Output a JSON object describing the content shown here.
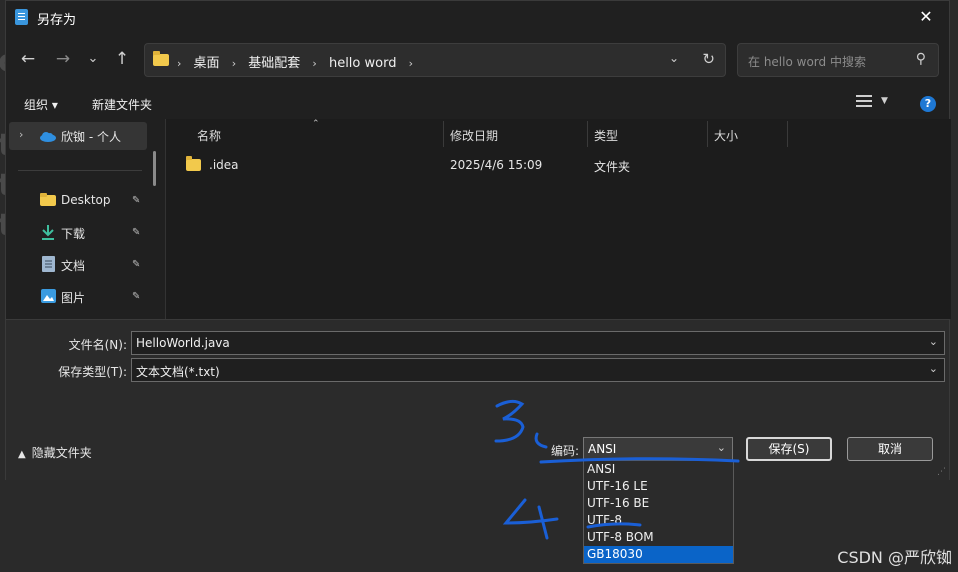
{
  "window": {
    "title": "另存为",
    "close_symbol": "✕"
  },
  "nav": {
    "back": "←",
    "forward": "→",
    "recent": "⌄",
    "up": "↑",
    "refresh": "↻"
  },
  "address": {
    "crumbs": [
      "桌面",
      "基础配套",
      "hello word"
    ],
    "separator": "›",
    "dropdown": "⌄"
  },
  "search": {
    "placeholder": "在 hello word 中搜索",
    "icon": "search-icon"
  },
  "toolbar": {
    "organize": "组织 ▾",
    "new_folder": "新建文件夹",
    "help": "?"
  },
  "sidebar": {
    "top_item": {
      "label": "欣铷 - 个人",
      "icon": "cloud-icon",
      "expander": "›"
    },
    "items": [
      {
        "label": "Desktop",
        "icon": "folder-icon"
      },
      {
        "label": "下载",
        "icon": "download-icon"
      },
      {
        "label": "文档",
        "icon": "document-icon"
      },
      {
        "label": "图片",
        "icon": "image-icon"
      }
    ],
    "pin_symbol": "📌"
  },
  "columns": [
    "名称",
    "修改日期",
    "类型",
    "大小"
  ],
  "sort_indicator": "⌃",
  "files": [
    {
      "name": ".idea",
      "modified": "2025/4/6 15:09",
      "type": "文件夹",
      "size": ""
    }
  ],
  "form": {
    "filename_label": "文件名(N):",
    "filename_value": "HelloWorld.java",
    "filetype_label": "保存类型(T):",
    "filetype_value": "文本文档(*.txt)",
    "hide_folders": "隐藏文件夹",
    "encoding_label": "编码:",
    "encoding_value": "ANSI",
    "save": "保存(S)",
    "cancel": "取消"
  },
  "encoding_options": [
    "ANSI",
    "UTF-16 LE",
    "UTF-16 BE",
    "UTF-8",
    "UTF-8 BOM",
    "GB18030"
  ],
  "encoding_highlighted": "GB18030",
  "annotations": {
    "step3": "3",
    "step4": "4",
    "color": "#1a5fd6"
  },
  "watermark": "CSDN @严欣铷",
  "background_fragments": [
    "c",
    "t",
    "t",
    "t"
  ]
}
